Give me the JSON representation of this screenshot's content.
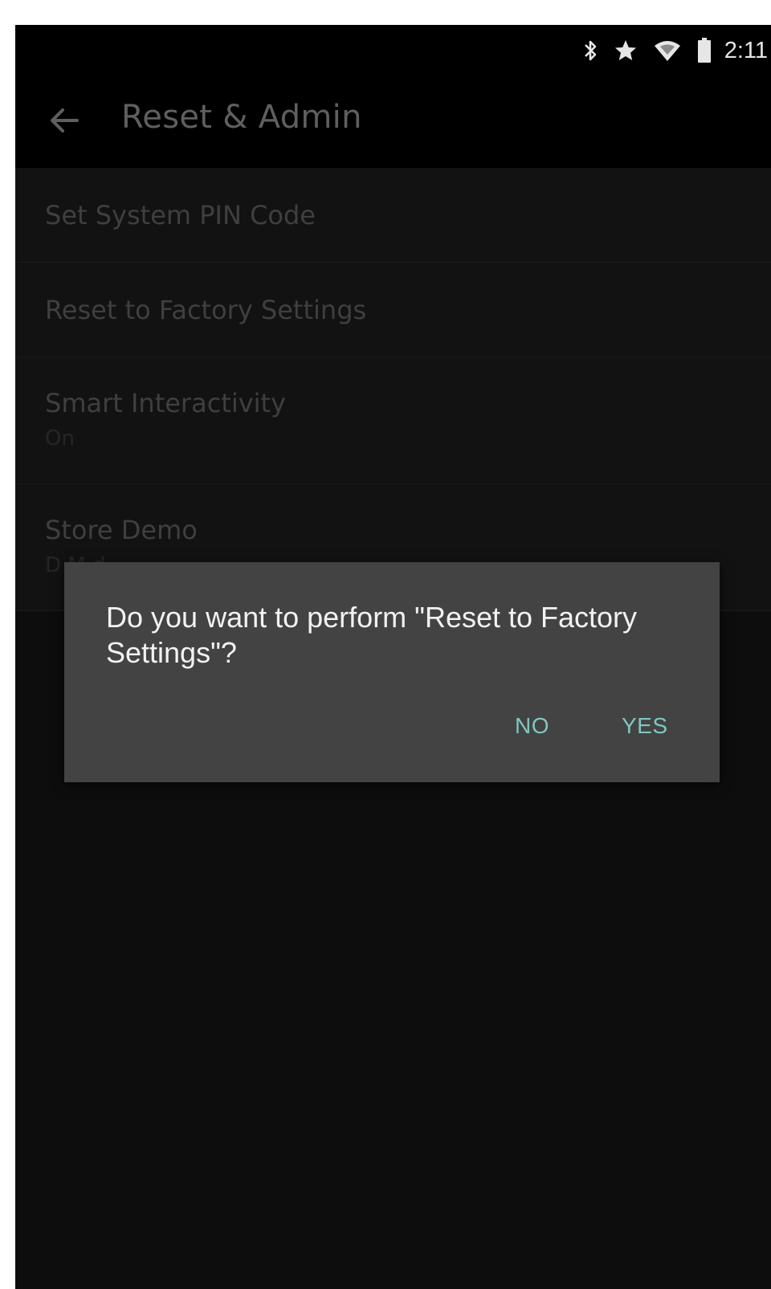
{
  "status_bar": {
    "time": "2:11",
    "icons": [
      "bluetooth-icon",
      "star-icon",
      "wifi-icon",
      "battery-icon"
    ]
  },
  "app_bar": {
    "title": "Reset & Admin",
    "back_icon": "arrow-left-icon"
  },
  "settings": {
    "items": [
      {
        "title": "Set System PIN Code",
        "subtitle": ""
      },
      {
        "title": "Reset to Factory Settings",
        "subtitle": ""
      },
      {
        "title": "Smart Interactivity",
        "subtitle": "On"
      },
      {
        "title": "Store Demo",
        "subtitle": "D   M   d"
      }
    ]
  },
  "dialog": {
    "message": "Do you want to perform \"Reset to Factory Settings\"?",
    "no_label": "NO",
    "yes_label": "YES"
  },
  "colors": {
    "accent": "#7fc7bf",
    "dialog_bg": "#434343",
    "screen_bg": "#0d0d0d"
  }
}
